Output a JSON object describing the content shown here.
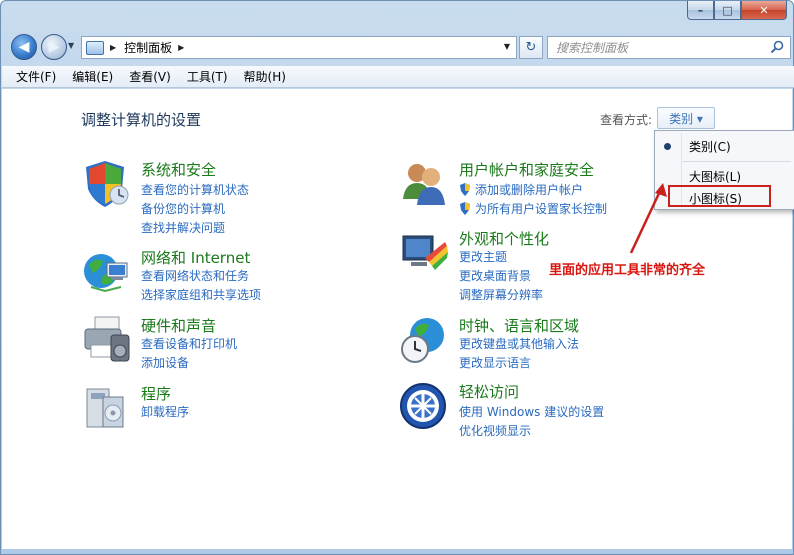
{
  "window": {
    "caption": {
      "minimize": "–",
      "maximize": "□",
      "close": "✕"
    }
  },
  "address": {
    "path": "控制面板",
    "search_placeholder": "搜索控制面板"
  },
  "menubar": [
    "文件(F)",
    "编辑(E)",
    "查看(V)",
    "工具(T)",
    "帮助(H)"
  ],
  "content": {
    "title": "调整计算机的设置",
    "view_label": "查看方式:",
    "view_value": "类别 ▾",
    "categories": [
      {
        "title": "系统和安全",
        "links": [
          "查看您的计算机状态",
          "备份您的计算机",
          "查找并解决问题"
        ]
      },
      {
        "title": "网络和 Internet",
        "links": [
          "查看网络状态和任务",
          "选择家庭组和共享选项"
        ]
      },
      {
        "title": "硬件和声音",
        "links": [
          "查看设备和打印机",
          "添加设备"
        ]
      },
      {
        "title": "程序",
        "links": [
          "卸载程序"
        ]
      },
      {
        "title": "用户帐户和家庭安全",
        "links": [
          "添加或删除用户帐户",
          "为所有用户设置家长控制"
        ]
      },
      {
        "title": "外观和个性化",
        "links": [
          "更改主题",
          "更改桌面背景",
          "调整屏幕分辨率"
        ]
      },
      {
        "title": "时钟、语言和区域",
        "links": [
          "更改键盘或其他输入法",
          "更改显示语言"
        ]
      },
      {
        "title": "轻松访问",
        "links": [
          "使用 Windows 建议的设置",
          "优化视频显示"
        ]
      }
    ]
  },
  "view_menu": {
    "items": [
      "类别(C)",
      "大图标(L)",
      "小图标(S)"
    ],
    "selected": "类别(C)"
  },
  "annotation": {
    "text": "里面的应用工具非常的齐全",
    "color": "#d8160f"
  }
}
